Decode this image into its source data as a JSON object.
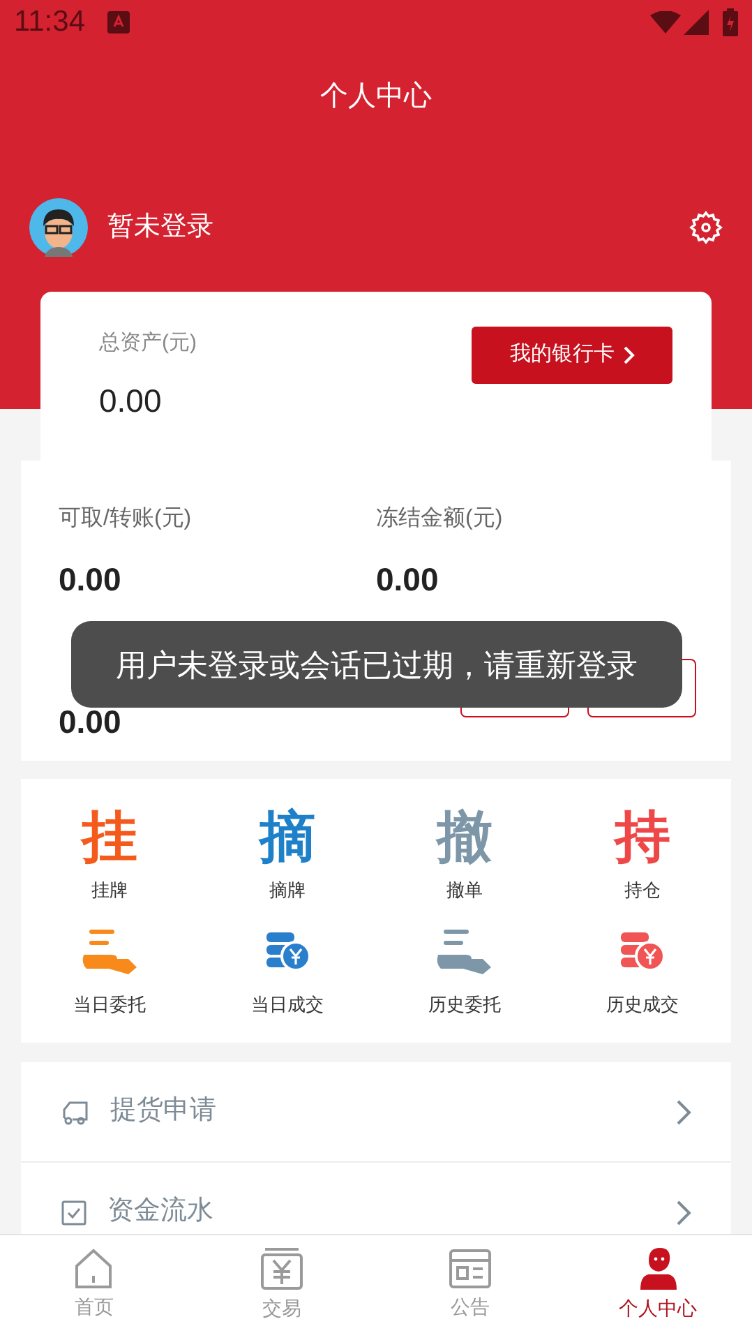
{
  "status_bar": {
    "time": "11:34"
  },
  "header": {
    "title": "个人中心",
    "user_name": "暂未登录"
  },
  "asset_card": {
    "label": "总资产(元)",
    "value": "0.00",
    "bank_button": "我的银行卡"
  },
  "funds": [
    {
      "label": "可取/转账(元)",
      "value": "0.00"
    },
    {
      "label": "冻结金额(元)",
      "value": "0.00"
    },
    {
      "value": "0.00"
    }
  ],
  "actions": [
    {
      "kind": "glyph",
      "glyph": "挂",
      "label": "挂牌",
      "color": "#f45a1c"
    },
    {
      "kind": "glyph",
      "glyph": "摘",
      "label": "摘牌",
      "color": "#1d80c8"
    },
    {
      "kind": "glyph",
      "glyph": "撤",
      "label": "撤单",
      "color": "#7d97a8"
    },
    {
      "kind": "glyph",
      "glyph": "持",
      "label": "持仓",
      "color": "#ef4747"
    },
    {
      "kind": "hand",
      "label": "当日委托",
      "color": "#f78a1a"
    },
    {
      "kind": "coins",
      "label": "当日成交",
      "color": "#2a7fcc"
    },
    {
      "kind": "hand",
      "label": "历史委托",
      "color": "#7d97a8"
    },
    {
      "kind": "coins",
      "label": "历史成交",
      "color": "#f05454"
    }
  ],
  "menu": [
    {
      "kind": "truck",
      "label": "提货申请"
    },
    {
      "kind": "check",
      "label": "资金流水"
    }
  ],
  "toast": "用户未登录或会话已过期，请重新登录",
  "tabs": [
    {
      "kind": "home",
      "label": "首页",
      "selected": false
    },
    {
      "kind": "trade",
      "label": "交易",
      "selected": false
    },
    {
      "kind": "notice",
      "label": "公告",
      "selected": false
    },
    {
      "kind": "person",
      "label": "个人中心",
      "selected": true
    }
  ]
}
